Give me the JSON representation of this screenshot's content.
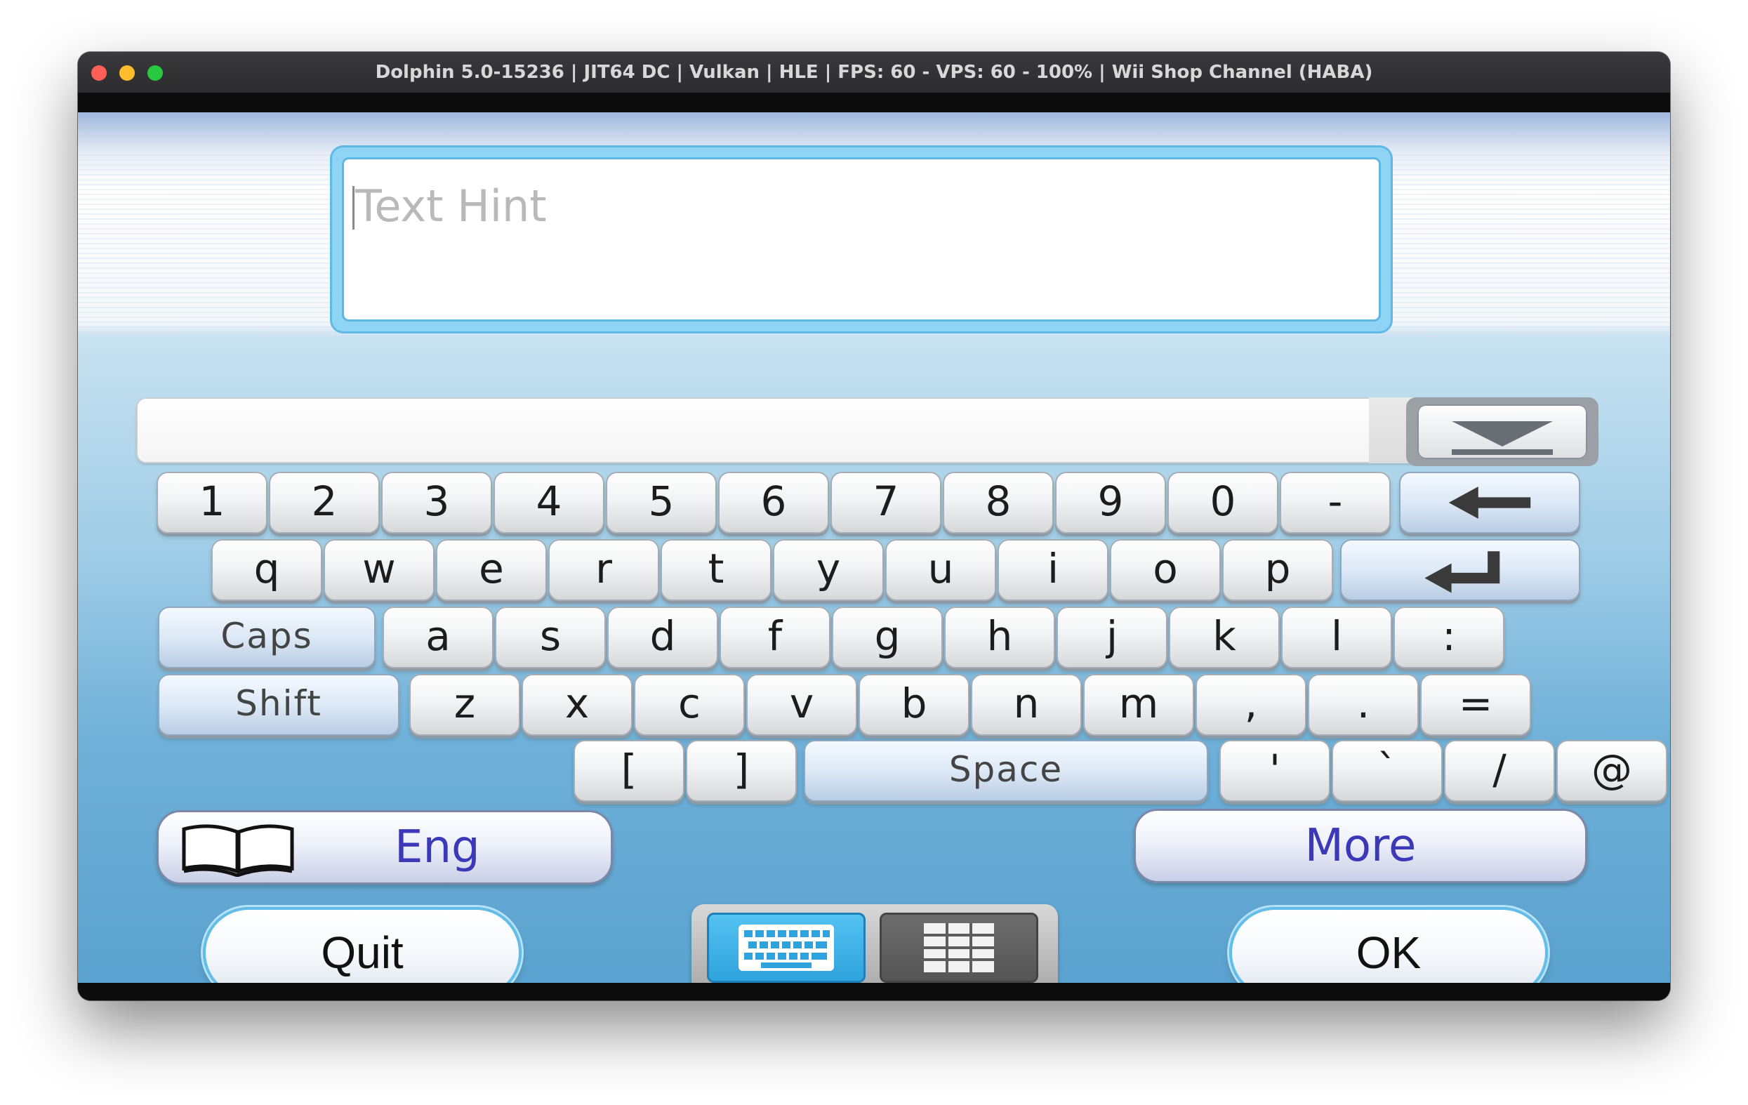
{
  "window": {
    "title": "Dolphin 5.0-15236 | JIT64 DC | Vulkan | HLE | FPS: 60 - VPS: 60 - 100% | Wii Shop Channel (HABA)"
  },
  "input": {
    "placeholder": "Text Hint",
    "value": ""
  },
  "keyboard": {
    "row1": [
      "1",
      "2",
      "3",
      "4",
      "5",
      "6",
      "7",
      "8",
      "9",
      "0",
      "-"
    ],
    "row2": [
      "q",
      "w",
      "e",
      "r",
      "t",
      "y",
      "u",
      "i",
      "o",
      "p"
    ],
    "row3": [
      "a",
      "s",
      "d",
      "f",
      "g",
      "h",
      "j",
      "k",
      "l",
      ":"
    ],
    "row4": [
      "z",
      "x",
      "c",
      "v",
      "b",
      "n",
      "m",
      ",",
      ".",
      "="
    ],
    "row5_left": [
      "[",
      "]"
    ],
    "row5_right": [
      "'",
      "`",
      "/",
      "@"
    ],
    "caps_label": "Caps",
    "shift_label": "Shift",
    "space_label": "Space"
  },
  "language_button": {
    "label": "Eng",
    "icon": "open-book-icon"
  },
  "more_button": {
    "label": "More"
  },
  "quit_button": {
    "label": "Quit"
  },
  "ok_button": {
    "label": "OK"
  },
  "mode_toggle": {
    "selected": "keyboard",
    "options": [
      "keyboard-icon",
      "grid-icon"
    ]
  },
  "icons": {
    "backspace": "left-arrow-icon",
    "enter": "return-arrow-icon",
    "suggestions": "dropdown-arrow-icon"
  },
  "colors": {
    "accent": "#5db6e4",
    "button_text": "#3b39b8",
    "mode_active": "#3aaee6"
  }
}
